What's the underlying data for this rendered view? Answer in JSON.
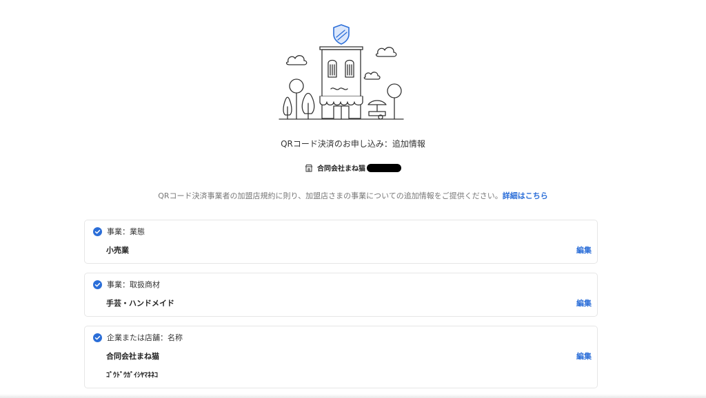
{
  "header": {
    "title": "QRコード決済のお申し込み：追加情報",
    "merchant_name": "合同会社まね猫"
  },
  "intro": {
    "text": "QRコード決済事業者の加盟店規約に則り、加盟店さまの事業についての追加情報をご提供ください。",
    "link_label": "詳細はこちら"
  },
  "cards": [
    {
      "label": "事業：業態",
      "value": "小売業",
      "edit_label": "編集"
    },
    {
      "label": "事業：取扱商材",
      "value": "手芸・ハンドメイド",
      "edit_label": "編集"
    },
    {
      "label": "企業または店舗：名称",
      "value": "合同会社まね猫",
      "value_kana": "ｺﾞｳﾄﾞｳｶﾞｲｼﾔﾏﾈﾈｺ",
      "edit_label": "編集"
    }
  ],
  "colors": {
    "accent": "#2b6ed8",
    "check": "#2b6ed8",
    "border": "#e6e6e6",
    "muted_text": "#777777"
  },
  "icons": {
    "hero": "storefront-illustration",
    "shield": "shield-icon",
    "merchant": "store-icon",
    "check": "check-circle-icon"
  }
}
